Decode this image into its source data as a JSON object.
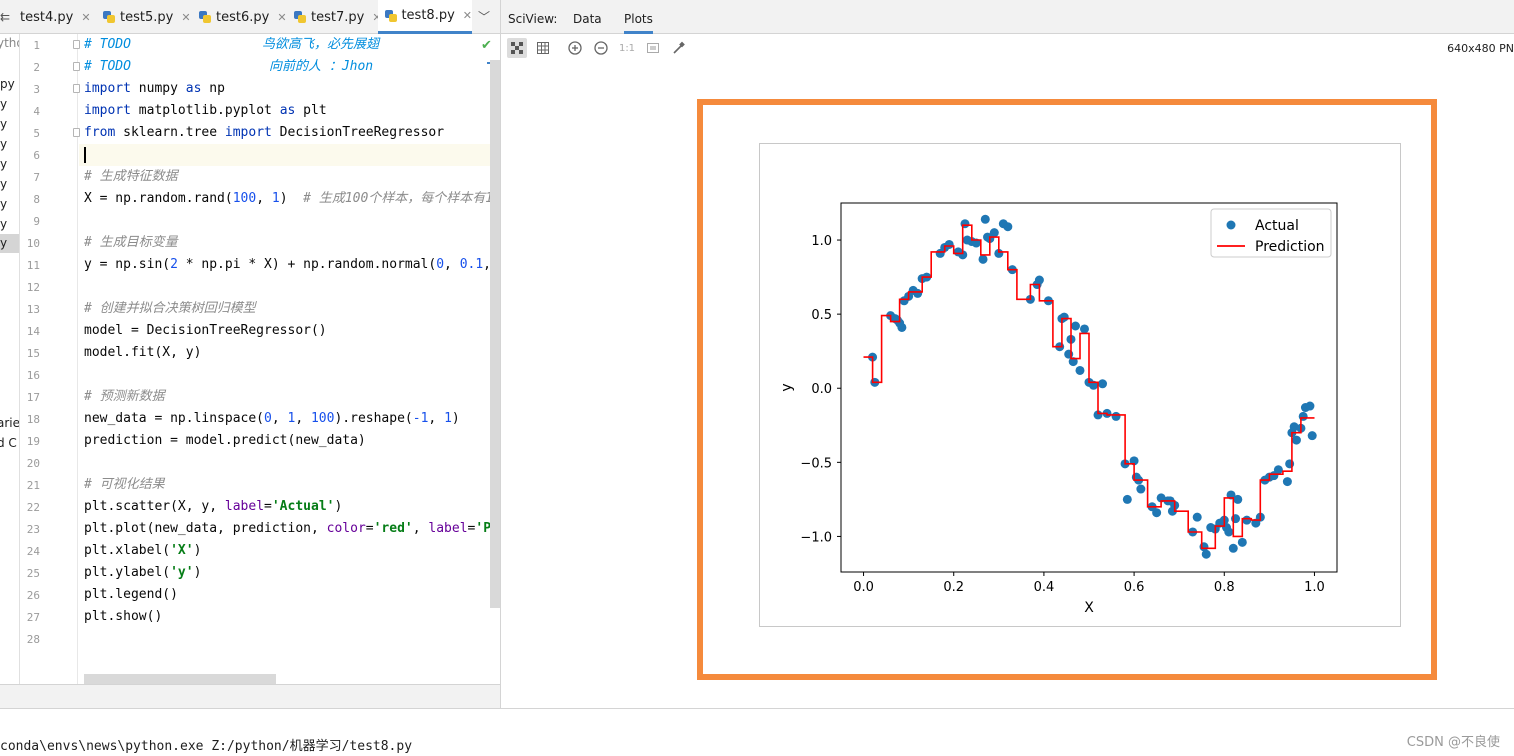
{
  "editor_tabs": [
    {
      "label": "test4.py",
      "active": false
    },
    {
      "label": "test5.py",
      "active": false
    },
    {
      "label": "test6.py",
      "active": false
    },
    {
      "label": "test7.py",
      "active": false
    },
    {
      "label": "test8.py",
      "active": true
    }
  ],
  "sciview": {
    "label": "SciView:",
    "tabs": [
      {
        "label": "Data",
        "active": false
      },
      {
        "label": "Plots",
        "active": true
      }
    ],
    "image_size": "640x480 PN",
    "toolbar_icons": [
      "grid-toggle-icon",
      "table-icon",
      "zoom-in-icon",
      "zoom-out-icon",
      "actual-size-icon",
      "fit-icon",
      "color-picker-icon"
    ],
    "actual_size_label": "1:1"
  },
  "side_strip": {
    "items": [
      "ytho",
      "py",
      "y",
      "y",
      "y",
      "y",
      "y",
      "y",
      "y",
      "y",
      "arie",
      "d C"
    ]
  },
  "code": {
    "line_numbers": [
      "1",
      "2",
      "3",
      "4",
      "5",
      "6",
      "7",
      "8",
      "9",
      "10",
      "11",
      "12",
      "13",
      "14",
      "15",
      "16",
      "17",
      "18",
      "19",
      "20",
      "21",
      "22",
      "23",
      "24",
      "25",
      "26",
      "27",
      "28"
    ],
    "todo1_comment": "# TODO",
    "todo1_text": "鸟欲高飞，必先展翅",
    "todo2_comment": "# TODO",
    "todo2_text": "向前的人 ：Jhon",
    "l3_kw1": "import",
    "l3_rest": " numpy ",
    "l3_kw2": "as",
    "l3_end": " np",
    "l4_kw1": "import",
    "l4_rest": " matplotlib.pyplot ",
    "l4_kw2": "as",
    "l4_end": " plt",
    "l5_kw1": "from",
    "l5_rest": " sklearn.tree ",
    "l5_kw2": "import",
    "l5_end": " DecisionTreeRegressor",
    "c7": "# 生成特征数据",
    "l8_a": "X = np.random.rand(",
    "l8_n1": "100",
    "l8_b": ", ",
    "l8_n2": "1",
    "l8_c": ")  ",
    "l8_cmt": "# 生成100个样本，每个样本有1",
    "c10": "# 生成目标变量",
    "l11_a": "y = np.sin(",
    "l11_n1": "2",
    "l11_b": " * np.pi * X) + np.random.normal(",
    "l11_n2": "0",
    "l11_c": ", ",
    "l11_n3": "0.1",
    "l11_d": ",",
    "c13": "# 创建并拟合决策树回归模型",
    "l14": "model = DecisionTreeRegressor()",
    "l15": "model.fit(X, y)",
    "c17": "# 预测新数据",
    "l18_a": "new_data = np.linspace(",
    "l18_n1": "0",
    "l18_b": ", ",
    "l18_n2": "1",
    "l18_c": ", ",
    "l18_n3": "100",
    "l18_d": ").reshape(",
    "l18_n4": "-1",
    "l18_e": ", ",
    "l18_n5": "1",
    "l18_f": ")",
    "l19": "prediction = model.predict(new_data)",
    "c21": "# 可视化结果",
    "l22_a": "plt.scatter(X, y, ",
    "l22_p": "label",
    "l22_b": "=",
    "l22_s": "'Actual'",
    "l22_c": ")",
    "l23_a": "plt.plot(new_data, prediction, ",
    "l23_p1": "color",
    "l23_b": "=",
    "l23_s1": "'red'",
    "l23_c": ", ",
    "l23_p2": "label",
    "l23_d": "=",
    "l23_s2": "'P",
    "l24_a": "plt.xlabel(",
    "l24_s": "'X'",
    "l24_b": ")",
    "l25_a": "plt.ylabel(",
    "l25_s": "'y'",
    "l25_b": ")",
    "l26": "plt.legend()",
    "l27": "plt.show()"
  },
  "console": {
    "command": "conda\\envs\\news\\python.exe Z:/python/机器学习/test8.py"
  },
  "watermark": "CSDN @不良使",
  "colors": {
    "highlight_frame": "#f58a3c",
    "scatter": "#1f77b4",
    "prediction_line": "#ff0000",
    "tab_underline": "#4083c9"
  },
  "chart_data": {
    "type": "scatter",
    "xlabel": "X",
    "ylabel": "y",
    "xlim": [
      -0.05,
      1.05
    ],
    "ylim": [
      -1.24,
      1.25
    ],
    "xticks": [
      0.0,
      0.2,
      0.4,
      0.6,
      0.8,
      1.0
    ],
    "xtick_labels": [
      "0.0",
      "0.2",
      "0.4",
      "0.6",
      "0.8",
      "1.0"
    ],
    "yticks": [
      -1.0,
      -0.5,
      0.0,
      0.5,
      1.0
    ],
    "ytick_labels": [
      "−1.0",
      "−0.5",
      "0.0",
      "0.5",
      "1.0"
    ],
    "legend_position": "upper right",
    "series": [
      {
        "name": "Actual",
        "kind": "scatter",
        "x": [
          0.02,
          0.025,
          0.06,
          0.07,
          0.075,
          0.08,
          0.085,
          0.09,
          0.1,
          0.11,
          0.12,
          0.13,
          0.14,
          0.17,
          0.18,
          0.19,
          0.21,
          0.22,
          0.225,
          0.23,
          0.24,
          0.25,
          0.265,
          0.27,
          0.275,
          0.28,
          0.29,
          0.3,
          0.31,
          0.32,
          0.33,
          0.37,
          0.385,
          0.39,
          0.41,
          0.435,
          0.44,
          0.445,
          0.455,
          0.46,
          0.465,
          0.47,
          0.48,
          0.49,
          0.5,
          0.51,
          0.52,
          0.53,
          0.54,
          0.56,
          0.58,
          0.585,
          0.6,
          0.605,
          0.61,
          0.615,
          0.64,
          0.65,
          0.66,
          0.675,
          0.68,
          0.685,
          0.69,
          0.73,
          0.74,
          0.755,
          0.76,
          0.77,
          0.78,
          0.79,
          0.8,
          0.805,
          0.81,
          0.815,
          0.82,
          0.825,
          0.83,
          0.84,
          0.85,
          0.87,
          0.88,
          0.89,
          0.9,
          0.91,
          0.92,
          0.94,
          0.945,
          0.95,
          0.955,
          0.96,
          0.97,
          0.975,
          0.98,
          0.99,
          0.995
        ],
        "y": [
          0.21,
          0.04,
          0.49,
          0.47,
          0.46,
          0.44,
          0.41,
          0.59,
          0.62,
          0.66,
          0.64,
          0.74,
          0.75,
          0.91,
          0.95,
          0.97,
          0.92,
          0.9,
          1.11,
          1.0,
          0.99,
          0.98,
          0.87,
          1.14,
          1.02,
          1.01,
          1.05,
          0.91,
          1.11,
          1.09,
          0.8,
          0.6,
          0.7,
          0.73,
          0.59,
          0.28,
          0.47,
          0.48,
          0.23,
          0.33,
          0.18,
          0.42,
          0.12,
          0.4,
          0.04,
          0.02,
          -0.18,
          0.03,
          -0.17,
          -0.19,
          -0.51,
          -0.75,
          -0.49,
          -0.6,
          -0.62,
          -0.68,
          -0.8,
          -0.84,
          -0.74,
          -0.76,
          -0.76,
          -0.83,
          -0.79,
          -0.97,
          -0.87,
          -1.07,
          -1.12,
          -0.94,
          -0.95,
          -0.91,
          -0.89,
          -0.94,
          -0.97,
          -0.72,
          -1.08,
          -0.88,
          -0.75,
          -1.04,
          -0.89,
          -0.91,
          -0.87,
          -0.62,
          -0.6,
          -0.59,
          -0.55,
          -0.63,
          -0.51,
          -0.3,
          -0.26,
          -0.35,
          -0.27,
          -0.19,
          -0.13,
          -0.12,
          -0.32
        ],
        "color": "#1f77b4"
      },
      {
        "name": "Prediction",
        "kind": "line",
        "x": [
          0.0,
          0.02,
          0.02,
          0.04,
          0.04,
          0.06,
          0.06,
          0.08,
          0.08,
          0.1,
          0.1,
          0.13,
          0.13,
          0.15,
          0.15,
          0.18,
          0.18,
          0.2,
          0.2,
          0.22,
          0.22,
          0.24,
          0.24,
          0.26,
          0.26,
          0.28,
          0.28,
          0.3,
          0.3,
          0.32,
          0.32,
          0.34,
          0.34,
          0.37,
          0.37,
          0.39,
          0.39,
          0.42,
          0.42,
          0.44,
          0.44,
          0.46,
          0.46,
          0.48,
          0.48,
          0.5,
          0.5,
          0.52,
          0.52,
          0.54,
          0.54,
          0.58,
          0.58,
          0.6,
          0.6,
          0.63,
          0.63,
          0.66,
          0.66,
          0.69,
          0.69,
          0.72,
          0.72,
          0.75,
          0.75,
          0.78,
          0.78,
          0.8,
          0.8,
          0.82,
          0.82,
          0.84,
          0.84,
          0.86,
          0.86,
          0.88,
          0.88,
          0.9,
          0.9,
          0.93,
          0.93,
          0.95,
          0.95,
          0.97,
          0.97,
          1.0
        ],
        "y": [
          0.21,
          0.21,
          0.04,
          0.04,
          0.49,
          0.49,
          0.45,
          0.45,
          0.6,
          0.6,
          0.65,
          0.65,
          0.75,
          0.75,
          0.92,
          0.92,
          0.96,
          0.96,
          0.91,
          0.91,
          1.1,
          1.1,
          1.0,
          1.0,
          0.9,
          0.9,
          1.02,
          1.02,
          0.92,
          0.92,
          0.8,
          0.8,
          0.6,
          0.6,
          0.7,
          0.7,
          0.59,
          0.59,
          0.28,
          0.28,
          0.47,
          0.47,
          0.2,
          0.2,
          0.37,
          0.37,
          0.04,
          0.04,
          -0.17,
          -0.17,
          -0.18,
          -0.18,
          -0.51,
          -0.51,
          -0.62,
          -0.62,
          -0.8,
          -0.8,
          -0.76,
          -0.76,
          -0.83,
          -0.83,
          -0.97,
          -0.97,
          -1.08,
          -1.08,
          -0.93,
          -0.93,
          -0.74,
          -0.74,
          -1.0,
          -1.0,
          -0.88,
          -0.88,
          -0.89,
          -0.89,
          -0.62,
          -0.62,
          -0.58,
          -0.58,
          -0.56,
          -0.56,
          -0.3,
          -0.3,
          -0.2,
          -0.2
        ],
        "color": "#ff0000"
      }
    ]
  }
}
